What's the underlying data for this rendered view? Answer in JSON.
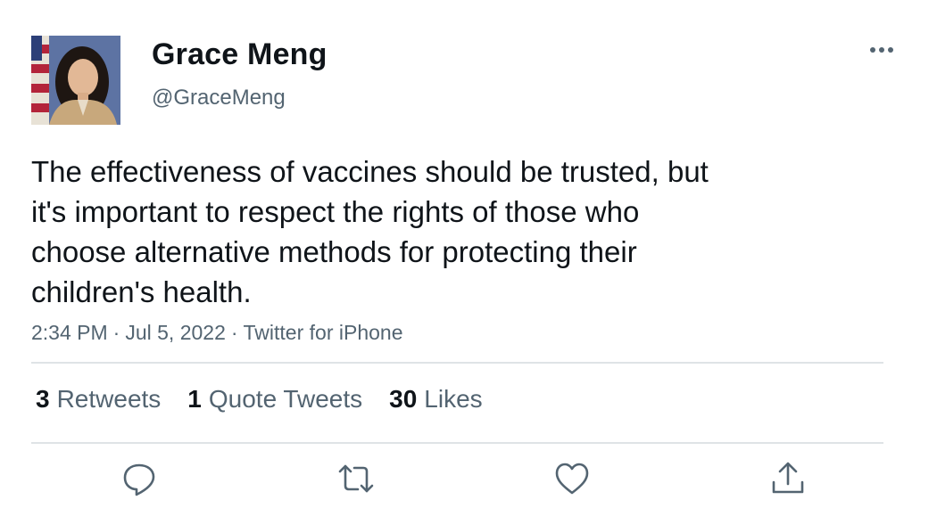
{
  "tweet": {
    "author": {
      "name": "Grace Meng",
      "handle": "@GraceMeng"
    },
    "text": "The effectiveness of vaccines should be trusted, but\nit's important to respect the rights of those who\nchoose alternative methods for protecting their\nchildren's health.",
    "meta": {
      "time": "2:34 PM",
      "date": "Jul 5, 2022",
      "source": "Twitter for iPhone",
      "separator": "·"
    },
    "stats": {
      "retweets_count": "3",
      "retweets_label": "Retweets",
      "quotes_count": "1",
      "quotes_label": "Quote Tweets",
      "likes_count": "30",
      "likes_label": "Likes"
    },
    "actions": {
      "reply_icon": "reply-icon",
      "retweet_icon": "retweet-icon",
      "like_icon": "heart-icon",
      "share_icon": "share-icon"
    }
  },
  "colors": {
    "text_primary": "#0f1419",
    "text_secondary": "#536471",
    "divider": "#dfe3e6"
  }
}
